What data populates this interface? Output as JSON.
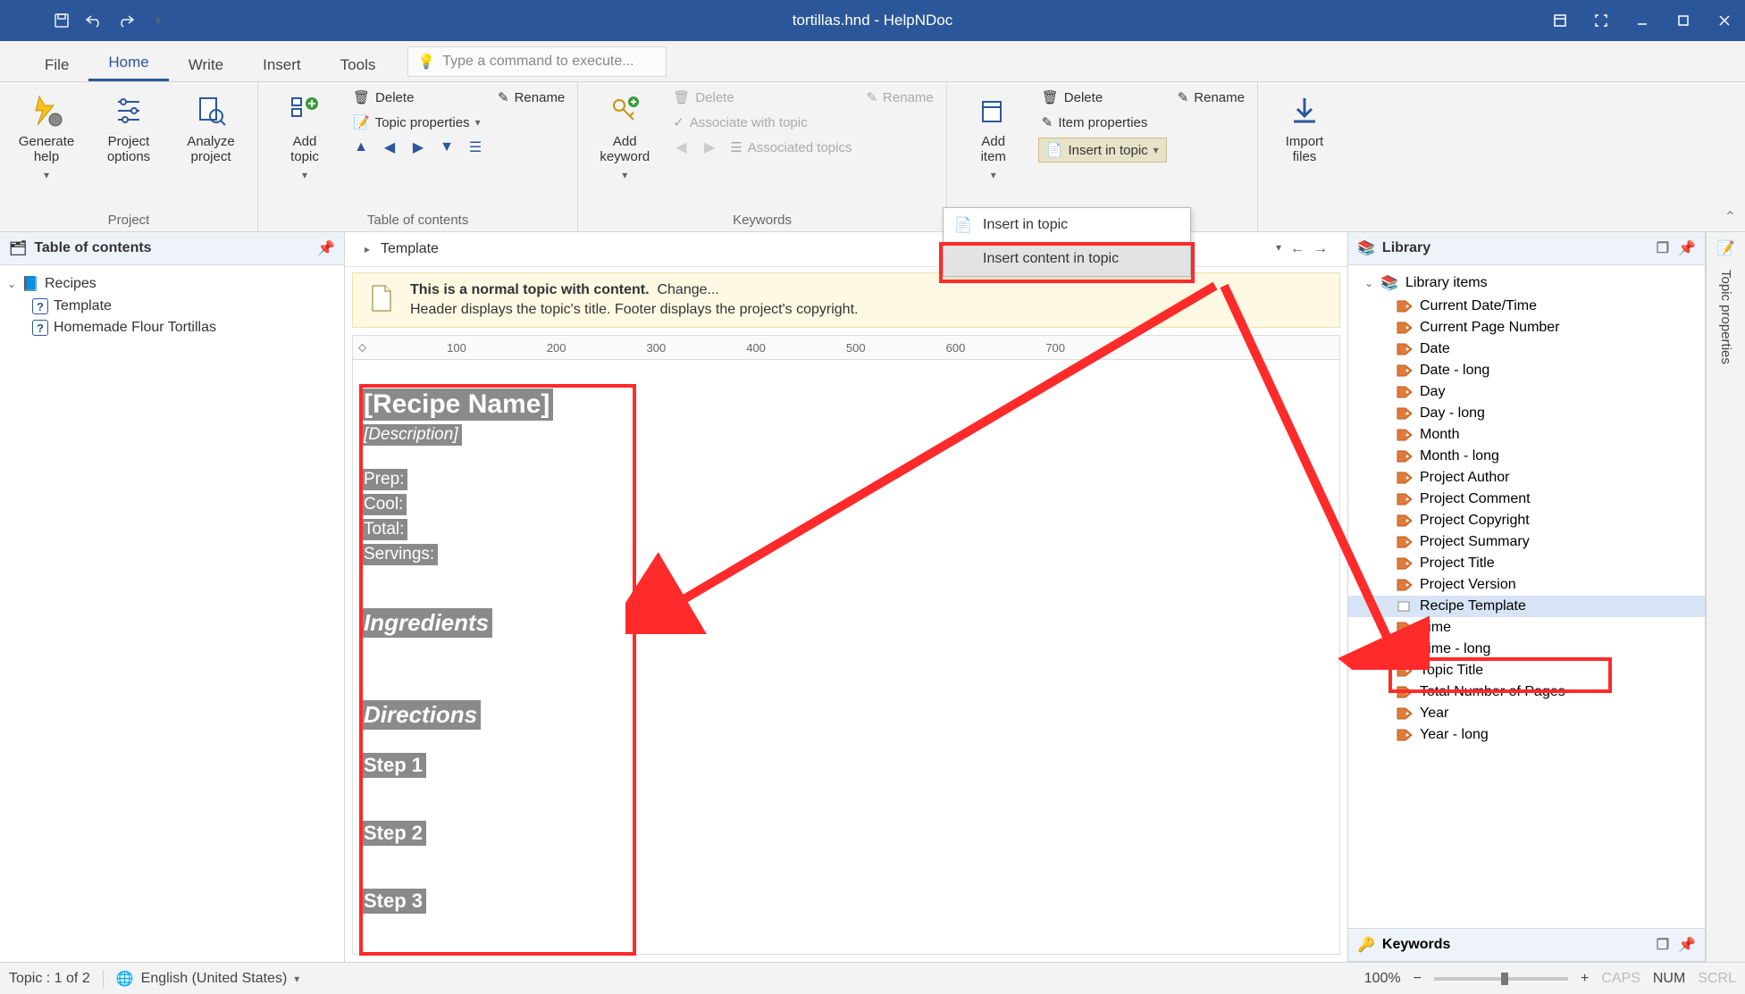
{
  "title": "tortillas.hnd - HelpNDoc",
  "tabs": {
    "file": "File",
    "home": "Home",
    "write": "Write",
    "insert": "Insert",
    "tools": "Tools"
  },
  "tellme_placeholder": "Type a command to execute...",
  "ribbon": {
    "project": {
      "label": "Project",
      "generate": "Generate\nhelp",
      "options": "Project\noptions",
      "analyze": "Analyze\nproject"
    },
    "toc": {
      "label": "Table of contents",
      "add": "Add\ntopic",
      "delete": "Delete",
      "rename": "Rename",
      "props": "Topic properties"
    },
    "keywords": {
      "label": "Keywords",
      "add": "Add\nkeyword",
      "delete": "Delete",
      "rename": "Rename",
      "assoc": "Associate with topic",
      "assoctop": "Associated topics"
    },
    "library": {
      "add": "Add\nitem",
      "delete": "Delete",
      "rename": "Rename",
      "props": "Item properties",
      "insert": "Insert in topic"
    },
    "import": {
      "import": "Import\nfiles"
    }
  },
  "insert_dropdown": {
    "a": "Insert in topic",
    "b": "Insert content in topic"
  },
  "toc_panel": {
    "title": "Table of contents",
    "root": "Recipes",
    "items": [
      "Template",
      "Homemade Flour Tortillas"
    ]
  },
  "breadcrumb": "Template",
  "infobar": {
    "bold": "This is a normal topic with content.",
    "change": "Change...",
    "line2": "Header displays the topic's title.   Footer displays the project's copyright."
  },
  "ruler_marks": [
    "100",
    "200",
    "300",
    "400",
    "500",
    "600",
    "700"
  ],
  "doc": {
    "name": "[Recipe Name]",
    "desc": "[Description]",
    "prep": "Prep:",
    "cool": "Cool:",
    "total": "Total:",
    "servings": "Servings:",
    "ingredients": "Ingredients",
    "directions": "Directions",
    "step1": "Step 1",
    "step2": "Step 2",
    "step3": "Step 3"
  },
  "library": {
    "title": "Library",
    "root": "Library items",
    "items": [
      "Current Date/Time",
      "Current Page Number",
      "Date",
      "Date - long",
      "Day",
      "Day - long",
      "Month",
      "Month - long",
      "Project Author",
      "Project Comment",
      "Project Copyright",
      "Project Summary",
      "Project Title",
      "Project Version",
      "Recipe Template",
      "Time",
      "Time - long",
      "Topic Title",
      "Total Number of Pages",
      "Year",
      "Year - long"
    ],
    "selected": "Recipe Template"
  },
  "keywords_panel": "Keywords",
  "vtab": "Topic properties",
  "status": {
    "topic": "Topic : 1 of 2",
    "lang": "English (United States)",
    "zoom": "100%",
    "caps": "CAPS",
    "num": "NUM",
    "scrl": "SCRL"
  }
}
